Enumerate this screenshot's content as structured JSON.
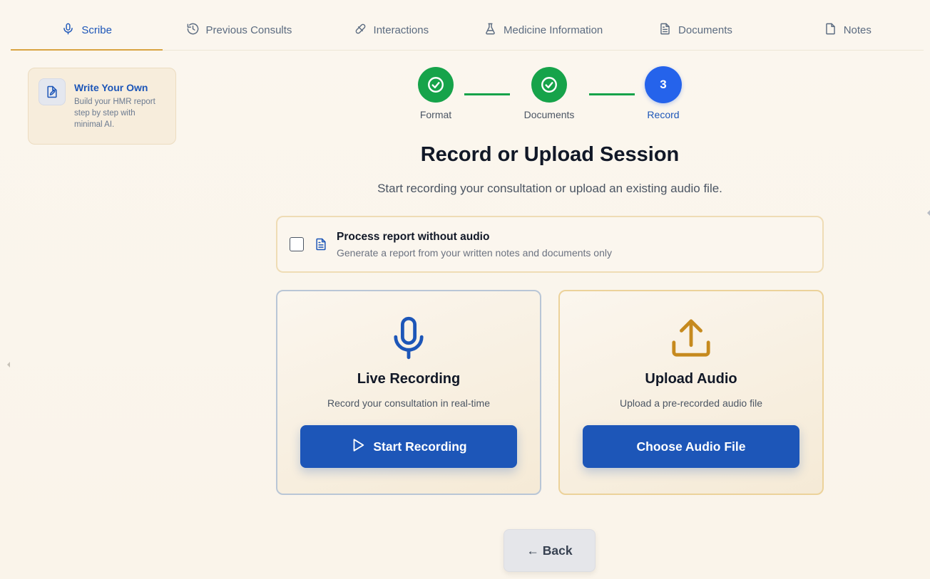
{
  "nav": {
    "tabs": [
      {
        "label": "Scribe",
        "icon": "mic-icon",
        "active": true
      },
      {
        "label": "Previous Consults",
        "icon": "history-icon",
        "active": false
      },
      {
        "label": "Interactions",
        "icon": "pill-icon",
        "active": false
      },
      {
        "label": "Medicine Information",
        "icon": "flask-icon",
        "active": false
      },
      {
        "label": "Documents",
        "icon": "document-icon",
        "active": false
      },
      {
        "label": "Notes",
        "icon": "note-icon",
        "active": false
      }
    ]
  },
  "sidebar": {
    "card": {
      "title": "Write Your Own",
      "description": "Build your HMR report step by step with minimal AI.",
      "icon": "edit-document-icon"
    }
  },
  "stepper": {
    "steps": [
      {
        "label": "Format",
        "state": "done"
      },
      {
        "label": "Documents",
        "state": "done"
      },
      {
        "label": "Record",
        "number": "3",
        "state": "current"
      }
    ]
  },
  "main": {
    "title": "Record or Upload Session",
    "subtitle": "Start recording your consultation or upload an existing audio file.",
    "no_audio": {
      "title": "Process report without audio",
      "description": "Generate a report from your written notes and documents only",
      "checked": false
    },
    "live_recording": {
      "title": "Live Recording",
      "description": "Record your consultation in real-time",
      "button": "Start Recording",
      "icon": "microphone-icon"
    },
    "upload_audio": {
      "title": "Upload Audio",
      "description": "Upload a pre-recorded audio file",
      "button": "Choose Audio File",
      "icon": "upload-icon"
    },
    "back_button": "← Back"
  },
  "colors": {
    "primary": "#1d56b8",
    "success": "#16a34a",
    "current_step": "#2563eb",
    "accent": "#d9a441",
    "background": "#faf5ec"
  }
}
